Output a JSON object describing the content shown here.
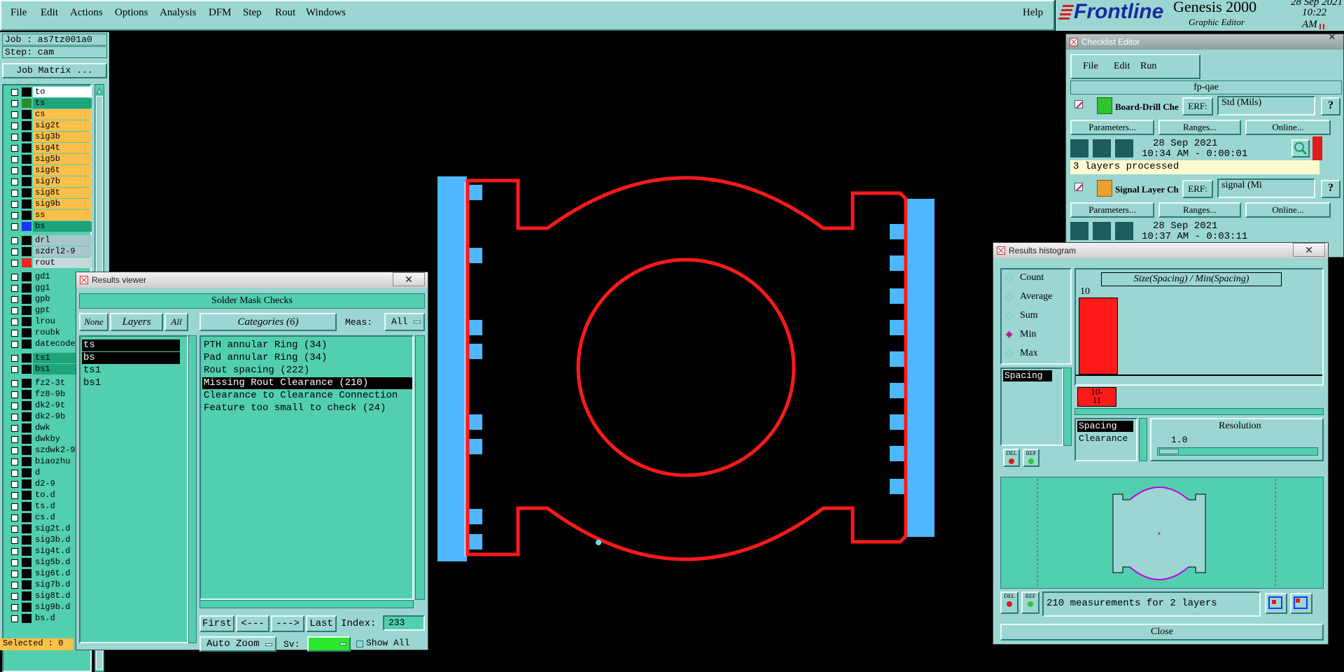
{
  "menubar": {
    "items": [
      "File",
      "Edit",
      "Actions",
      "Options",
      "Analysis",
      "DFM",
      "Step",
      "Rout",
      "Windows"
    ],
    "help": "Help"
  },
  "brand": {
    "logo_text": "Frontline",
    "product": "Genesis 2000",
    "subtitle": "Graphic Editor",
    "date": "28 Sep 2021",
    "time": "10:22 AM"
  },
  "left": {
    "job": "Job : as7tz001a0",
    "step": "Step: cam",
    "job_matrix": "Job Matrix ...",
    "selected": "Selected : 0",
    "layers": [
      {
        "name": "to",
        "bg": "#ffffff",
        "chip": "#000000"
      },
      {
        "name": "ts",
        "bg": "#1fa37b",
        "chip": "#2a8c2a"
      },
      {
        "name": "cs",
        "bg": "#ffc04a",
        "chip": "#000000"
      },
      {
        "name": "sig2t",
        "bg": "#ffc04a",
        "chip": "#000000"
      },
      {
        "name": "sig3b",
        "bg": "#ffc04a",
        "chip": "#000000"
      },
      {
        "name": "sig4t",
        "bg": "#ffc04a",
        "chip": "#000000"
      },
      {
        "name": "sig5b",
        "bg": "#ffc04a",
        "chip": "#000000"
      },
      {
        "name": "sig6t",
        "bg": "#ffc04a",
        "chip": "#000000"
      },
      {
        "name": "sig7b",
        "bg": "#ffc04a",
        "chip": "#000000"
      },
      {
        "name": "sig8t",
        "bg": "#ffc04a",
        "chip": "#000000"
      },
      {
        "name": "sig9b",
        "bg": "#ffc04a",
        "chip": "#000000"
      },
      {
        "name": "ss",
        "bg": "#ffc04a",
        "chip": "#000000"
      },
      {
        "name": "bs",
        "bg": "#1fa37b",
        "chip": "#1a37ff"
      },
      {
        "name": "drl",
        "bg": "#a9c7cb",
        "chip": "#000000"
      },
      {
        "name": "szdrl2-9",
        "bg": "#a9c7cb",
        "chip": "#000000"
      },
      {
        "name": "rout",
        "bg": "#c7d7da",
        "chip": "#ff2020"
      },
      {
        "name": "gd1",
        "bg": "#52cfae",
        "chip": "#000000"
      },
      {
        "name": "gg1",
        "bg": "#52cfae",
        "chip": "#000000"
      },
      {
        "name": "gpb",
        "bg": "#52cfae",
        "chip": "#000000"
      },
      {
        "name": "gpt",
        "bg": "#52cfae",
        "chip": "#000000"
      },
      {
        "name": "lrou",
        "bg": "#52cfae",
        "chip": "#000000"
      },
      {
        "name": "roubk",
        "bg": "#52cfae",
        "chip": "#000000"
      },
      {
        "name": "datecode-",
        "bg": "#52cfae",
        "chip": "#000000"
      },
      {
        "name": "ts1",
        "bg": "#1fa37b",
        "chip": "#000000"
      },
      {
        "name": "bs1",
        "bg": "#1fa37b",
        "chip": "#000000"
      },
      {
        "name": "fz2-3t",
        "bg": "#52cfae",
        "chip": "#000000"
      },
      {
        "name": "fz8-9b",
        "bg": "#52cfae",
        "chip": "#000000"
      },
      {
        "name": "dk2-9t",
        "bg": "#52cfae",
        "chip": "#000000"
      },
      {
        "name": "dk2-9b",
        "bg": "#52cfae",
        "chip": "#000000"
      },
      {
        "name": "dwk",
        "bg": "#52cfae",
        "chip": "#000000"
      },
      {
        "name": "dwkby",
        "bg": "#52cfae",
        "chip": "#000000"
      },
      {
        "name": "szdwk2-9",
        "bg": "#52cfae",
        "chip": "#000000"
      },
      {
        "name": "biaozhu",
        "bg": "#52cfae",
        "chip": "#000000"
      },
      {
        "name": "d",
        "bg": "#52cfae",
        "chip": "#000000"
      },
      {
        "name": "d2-9",
        "bg": "#52cfae",
        "chip": "#000000"
      },
      {
        "name": "to.d",
        "bg": "#52cfae",
        "chip": "#000000"
      },
      {
        "name": "ts.d",
        "bg": "#52cfae",
        "chip": "#000000"
      },
      {
        "name": "cs.d",
        "bg": "#52cfae",
        "chip": "#000000"
      },
      {
        "name": "sig2t.d",
        "bg": "#52cfae",
        "chip": "#000000"
      },
      {
        "name": "sig3b.d",
        "bg": "#52cfae",
        "chip": "#000000"
      },
      {
        "name": "sig4t.d",
        "bg": "#52cfae",
        "chip": "#000000"
      },
      {
        "name": "sig5b.d",
        "bg": "#52cfae",
        "chip": "#000000"
      },
      {
        "name": "sig6t.d",
        "bg": "#52cfae",
        "chip": "#000000"
      },
      {
        "name": "sig7b.d",
        "bg": "#52cfae",
        "chip": "#000000"
      },
      {
        "name": "sig8t.d",
        "bg": "#52cfae",
        "chip": "#000000"
      },
      {
        "name": "sig9b.d",
        "bg": "#52cfae",
        "chip": "#000000"
      },
      {
        "name": "bs.d",
        "bg": "#52cfae",
        "chip": "#000000"
      }
    ]
  },
  "results_viewer": {
    "title": "Results viewer",
    "header": "Solder Mask Checks",
    "none": "None",
    "layers": "Layers",
    "all": "All",
    "categories_btn": "Categories (6)",
    "meas_label": "Meas:",
    "meas_value": "All",
    "layer_list": [
      "ts",
      "bs",
      "ts1",
      "bs1"
    ],
    "category_list": [
      "PTH annular Ring (34)",
      "Pad annular Ring (34)",
      "Rout spacing (222)",
      "Missing Rout Clearance (210)",
      "Clearance to Clearance Connection",
      "Feature too small to check (24)"
    ],
    "first": "First",
    "prev": "<---",
    "next": "--->",
    "last": "Last",
    "index_label": "Index:",
    "index_value": "233",
    "auto_zoom": "Auto Zoom",
    "sv_label": "Sv:",
    "show_all": "Show All"
  },
  "checklist": {
    "title": "Checklist Editor",
    "menu": [
      "File",
      "Edit",
      "Run"
    ],
    "name": "fp-qae",
    "items": [
      {
        "name": "Board-Drill Che",
        "erf_label": "ERF:",
        "erf_value": "Std (Mils)",
        "params": "Parameters...",
        "ranges": "Ranges...",
        "online": "Online...",
        "date": "28 Sep 2021",
        "time": "10:34 AM - 0:00:01",
        "status": "3 layers processed"
      },
      {
        "name": "Signal Layer Ch",
        "erf_label": "ERF:",
        "erf_value": "signal (Mi",
        "params": "Parameters...",
        "ranges": "Ranges...",
        "online": "Online...",
        "date": "28 Sep 2021",
        "time": "10:37 AM - 0:03:11"
      }
    ]
  },
  "histogram": {
    "title": "Results histogram",
    "options": [
      "Count",
      "Average",
      "Sum",
      "Min",
      "Max"
    ],
    "selected_option": "Min",
    "chart_title": "Size(Spacing) / Min(Spacing)",
    "bar_value": "10",
    "bin_label": "10-\n11",
    "measure_list": [
      "Spacing"
    ],
    "del": "DEL",
    "ref": "REF",
    "type_list": [
      "Spacing",
      "Clearance"
    ],
    "resolution_label": "Resolution",
    "resolution_value": "1.0",
    "summary": "210 measurements for 2 layers",
    "close": "Close"
  }
}
